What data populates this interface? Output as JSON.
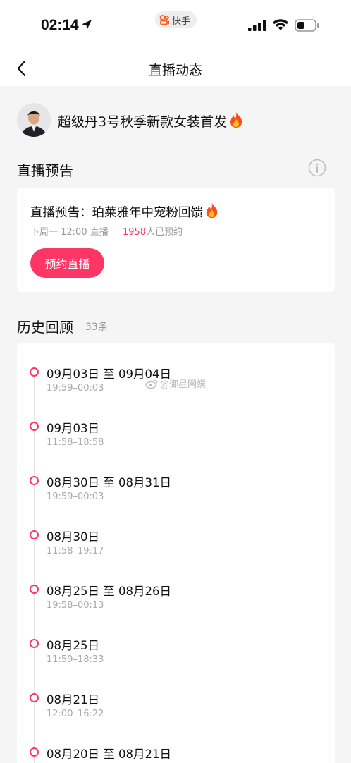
{
  "status_bar": {
    "time": "02:14",
    "app_badge": "快手"
  },
  "nav": {
    "title": "直播动态"
  },
  "host": {
    "title": "超级丹3号秋季新款女装首发"
  },
  "preview": {
    "section_title": "直播预告",
    "card_title": "直播预告：珀莱雅年中宠粉回馈",
    "schedule": "下周一 12:00 直播",
    "booked_count": "1958",
    "booked_suffix": "人已预约",
    "book_button": "预约直播"
  },
  "history": {
    "section_title": "历史回顾",
    "count": "33条",
    "items": [
      {
        "date": "09月03日 至 09月04日",
        "time": "19:59–00:03"
      },
      {
        "date": "09月03日",
        "time": "11:58–18:58"
      },
      {
        "date": "08月30日 至 08月31日",
        "time": "19:59–00:03"
      },
      {
        "date": "08月30日",
        "time": "11:58–19:17"
      },
      {
        "date": "08月25日 至 08月26日",
        "time": "19:58–00:13"
      },
      {
        "date": "08月25日",
        "time": "11:59–18:33"
      },
      {
        "date": "08月21日",
        "time": "12:00–16:22"
      },
      {
        "date": "08月20日 至 08月21日",
        "time": ""
      }
    ]
  },
  "watermark": "@御星网娱",
  "colors": {
    "accent": "#fe3666",
    "background": "#f5f5f6",
    "card": "#ffffff"
  }
}
